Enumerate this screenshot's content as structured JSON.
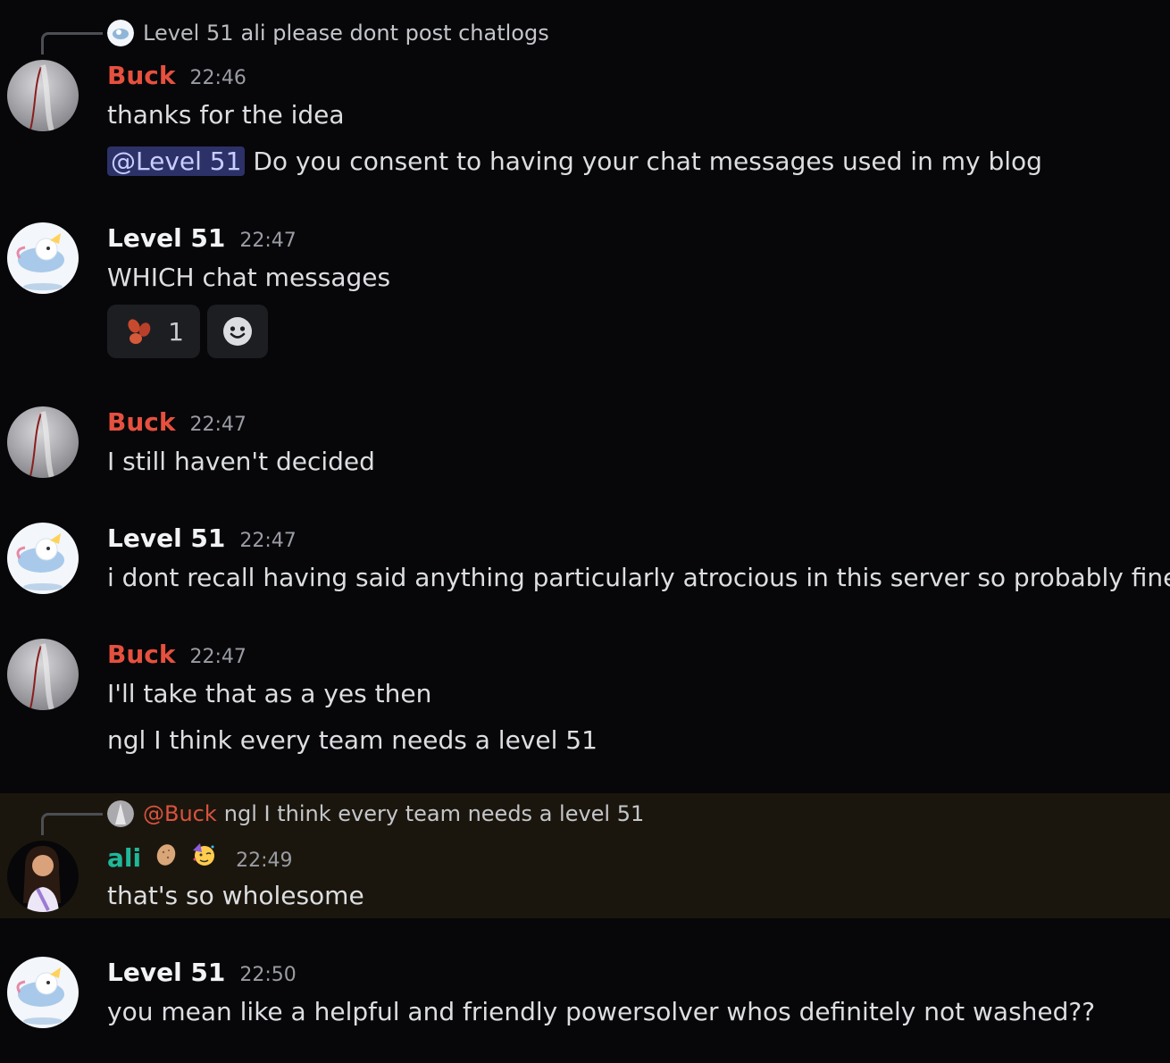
{
  "messages": [
    {
      "reply": {
        "author": "Level 51",
        "text": "ali please dont post chatlogs"
      },
      "author": "Buck",
      "time": "22:46",
      "lines": [
        "thanks for the idea"
      ],
      "mention_line": {
        "mention": "@Level 51",
        "text": "Do you consent to having your chat messages used in my blog"
      }
    },
    {
      "author": "Level 51",
      "time": "22:47",
      "lines": [
        "WHICH chat messages"
      ],
      "reactions": [
        {
          "emoji": "beans-emoji",
          "count": "1"
        },
        {
          "emoji": "add-reaction-icon"
        }
      ]
    },
    {
      "author": "Buck",
      "time": "22:47",
      "lines": [
        "I still haven't decided"
      ]
    },
    {
      "author": "Level 51",
      "time": "22:47",
      "lines": [
        "i dont recall having said anything particularly atrocious in this server so probably fine"
      ]
    },
    {
      "author": "Buck",
      "time": "22:47",
      "lines": [
        "I'll take that as a yes then",
        "ngl I think every team needs a level 51"
      ]
    },
    {
      "reply": {
        "author": "@Buck",
        "text": "ngl I think every team needs a level 51"
      },
      "author": "ali",
      "time": "22:49",
      "badges": [
        "potato-icon",
        "party-face-icon"
      ],
      "lines": [
        "that's so wholesome"
      ],
      "highlight_color": "#1b160d"
    },
    {
      "author": "Level 51",
      "time": "22:50",
      "lines": [
        "you mean like a helpful and friendly powersolver whos definitely not washed??"
      ]
    }
  ],
  "colors": {
    "background": "#070709",
    "buck": "#e5503f",
    "level51": "#f2f3f5",
    "ali": "#1fb89a",
    "mention_bg": "#2c3168"
  }
}
